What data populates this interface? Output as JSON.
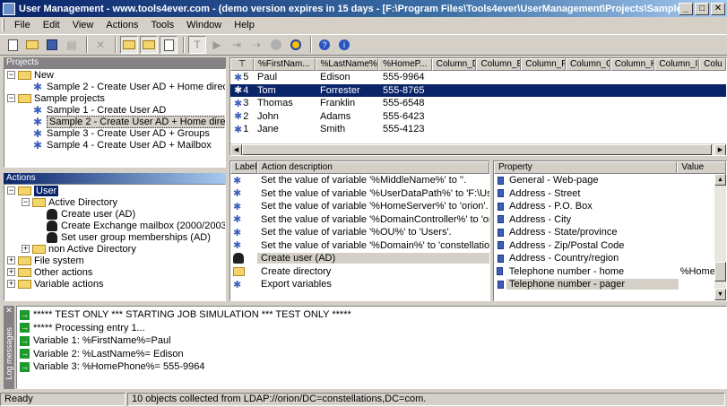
{
  "window": {
    "title": "User Management - www.tools4ever.com - (demo version expires in 15 days - [F:\\Program Files\\Tools4ever\\UserManagement\\Projects\\Sample 2 - Create...",
    "min": "_",
    "max": "□",
    "close": "✕"
  },
  "menu": [
    "File",
    "Edit",
    "View",
    "Actions",
    "Tools",
    "Window",
    "Help"
  ],
  "projects": {
    "header": "Projects",
    "items": [
      {
        "label": "New",
        "level": 0,
        "type": "folder",
        "exp": "−"
      },
      {
        "label": "Sample 2 - Create User AD + Home directory1",
        "level": 1,
        "type": "gear"
      },
      {
        "label": "Sample projects",
        "level": 0,
        "type": "folder",
        "exp": "−"
      },
      {
        "label": "Sample 1 - Create User AD",
        "level": 1,
        "type": "gear"
      },
      {
        "label": "Sample 2 - Create User AD + Home directory",
        "level": 1,
        "type": "gear",
        "highlight": true
      },
      {
        "label": "Sample 3 - Create User AD + Groups",
        "level": 1,
        "type": "gear"
      },
      {
        "label": "Sample 4 - Create User AD + Mailbox",
        "level": 1,
        "type": "gear"
      }
    ]
  },
  "actions": {
    "header": "Actions",
    "items": [
      {
        "label": "User",
        "level": 0,
        "type": "folder",
        "exp": "−",
        "selected": true
      },
      {
        "label": "Active Directory",
        "level": 1,
        "type": "folder",
        "exp": "−"
      },
      {
        "label": "Create user (AD)",
        "level": 2,
        "type": "user"
      },
      {
        "label": "Create Exchange mailbox (2000/2003)",
        "level": 2,
        "type": "user"
      },
      {
        "label": "Set user group memberships (AD)",
        "level": 2,
        "type": "user"
      },
      {
        "label": "non Active Directory",
        "level": 1,
        "type": "folder",
        "exp": "+"
      },
      {
        "label": "File system",
        "level": 0,
        "type": "folder",
        "exp": "+"
      },
      {
        "label": "Other actions",
        "level": 0,
        "type": "folder",
        "exp": "+"
      },
      {
        "label": "Variable actions",
        "level": 0,
        "type": "folder",
        "exp": "+"
      }
    ]
  },
  "data_grid": {
    "columns": [
      "%FirstNam...",
      "%LastName%",
      "%HomeP...",
      "Column_D",
      "Column_E",
      "Column_F",
      "Column_G",
      "Column_H",
      "Column_I",
      "Colu"
    ],
    "rows": [
      {
        "idx": "5",
        "first": "Paul",
        "last": "Edison",
        "phone": "555-9964"
      },
      {
        "idx": "4",
        "first": "Tom",
        "last": "Forrester",
        "phone": "555-8765",
        "selected": true
      },
      {
        "idx": "3",
        "first": "Thomas",
        "last": "Franklin",
        "phone": "555-6548"
      },
      {
        "idx": "2",
        "first": "John",
        "last": "Adams",
        "phone": "555-6423"
      },
      {
        "idx": "1",
        "first": "Jane",
        "last": "Smith",
        "phone": "555-4123"
      }
    ]
  },
  "action_list": {
    "col_label": "Label",
    "col_desc": "Action description",
    "rows": [
      {
        "icon": "gear",
        "desc": "Set the value of variable '%MiddleName%' to ''."
      },
      {
        "icon": "gear",
        "desc": "Set the value of variable '%UserDataPath%' to 'F:\\Users'."
      },
      {
        "icon": "gear",
        "desc": "Set the value of variable '%HomeServer%' to 'orion'."
      },
      {
        "icon": "gear",
        "desc": "Set the value of variable '%DomainController%' to 'orion'."
      },
      {
        "icon": "gear",
        "desc": "Set the value of variable '%OU%' to 'Users'."
      },
      {
        "icon": "gear",
        "desc": "Set the value of variable '%Domain%' to 'constellations.com'."
      },
      {
        "icon": "user",
        "desc": "Create user (AD)",
        "current": true
      },
      {
        "icon": "folder",
        "desc": "Create directory"
      },
      {
        "icon": "gear",
        "desc": "Export variables"
      }
    ]
  },
  "properties": {
    "col_property": "Property",
    "col_value": "Value",
    "rows": [
      {
        "name": "General - Web-page",
        "value": ""
      },
      {
        "name": "Address - Street",
        "value": ""
      },
      {
        "name": "Address - P.O. Box",
        "value": ""
      },
      {
        "name": "Address - City",
        "value": ""
      },
      {
        "name": "Address - State/province",
        "value": ""
      },
      {
        "name": "Address - Zip/Postal Code",
        "value": ""
      },
      {
        "name": "Address - Country/region",
        "value": ""
      },
      {
        "name": "Telephone number - home",
        "value": "%Home"
      },
      {
        "name": "Telephone number - pager",
        "value": "",
        "current": true
      }
    ]
  },
  "log": {
    "side_label": "Log messages",
    "close": "✕",
    "lines": [
      "***** TEST ONLY *** STARTING JOB SIMULATION *** TEST ONLY *****",
      "***** Processing entry 1...",
      "Variable  1: %FirstName%=Paul",
      "Variable  2: %LastName%= Edison",
      "Variable  3: %HomePhone%= 555-9964"
    ]
  },
  "status": {
    "left": "Ready",
    "right": "10 objects collected from LDAP://orion/DC=constellations,DC=com."
  }
}
